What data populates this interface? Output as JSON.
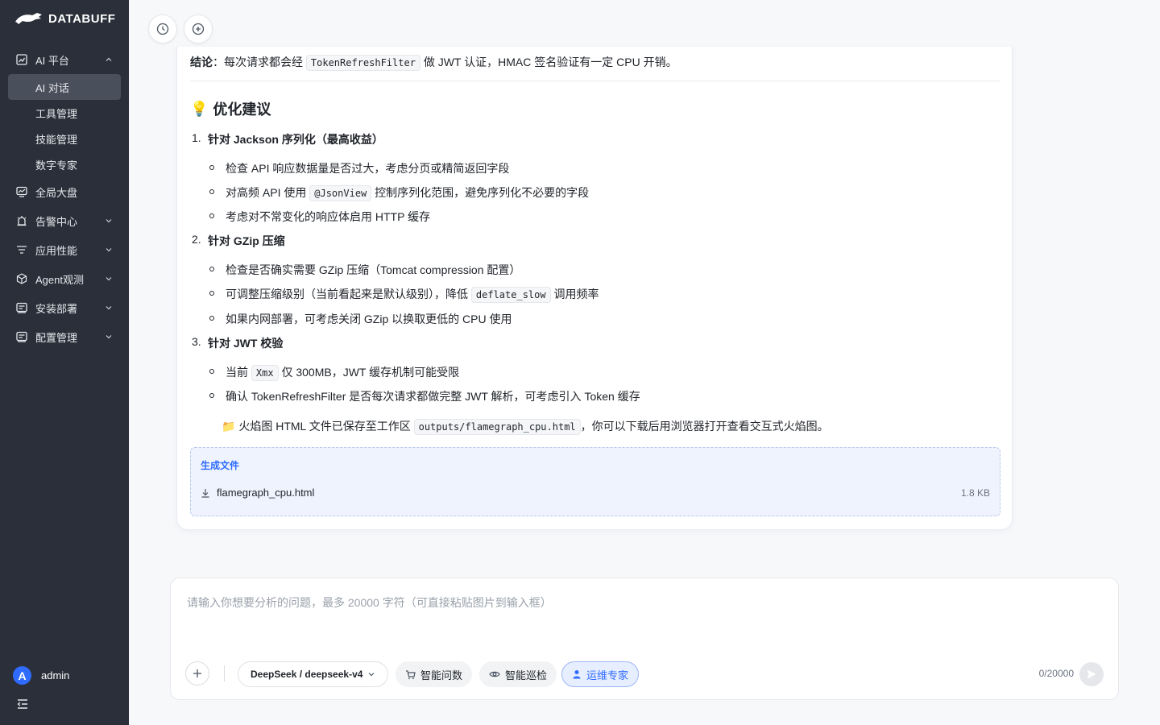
{
  "brand": {
    "name": "DATABUFF"
  },
  "sidebar": {
    "items": [
      {
        "label": "AI 平台",
        "expanded": true,
        "children": [
          {
            "label": "AI 对话",
            "active": true
          },
          {
            "label": "工具管理"
          },
          {
            "label": "技能管理"
          },
          {
            "label": "数字专家"
          }
        ]
      },
      {
        "label": "全局大盘"
      },
      {
        "label": "告警中心"
      },
      {
        "label": "应用性能"
      },
      {
        "label": "Agent观测"
      },
      {
        "label": "安装部署"
      },
      {
        "label": "配置管理"
      }
    ],
    "user": {
      "avatar_letter": "A",
      "name": "admin"
    }
  },
  "message": {
    "conclusion_label": "结论",
    "conclusion_pre": "：每次请求都会经",
    "conclusion_code": "TokenRefreshFilter",
    "conclusion_post": "做 JWT 认证，HMAC 签名验证有一定 CPU 开销。",
    "section_icon": "💡",
    "section_title": "优化建议",
    "items": [
      {
        "num": "1.",
        "title": "针对 Jackson 序列化（最高收益）",
        "bullets": [
          {
            "pre": "检查 API 响应数据量是否过大，考虑分页或精简返回字段"
          },
          {
            "pre": "对高频 API 使用",
            "code": "@JsonView",
            "post": "控制序列化范围，避免序列化不必要的字段"
          },
          {
            "pre": "考虑对不常变化的响应体启用 HTTP 缓存"
          }
        ]
      },
      {
        "num": "2.",
        "title": "针对 GZip 压缩",
        "bullets": [
          {
            "pre": "检查是否确实需要 GZip 压缩（Tomcat compression 配置）"
          },
          {
            "pre": "可调整压缩级别（当前看起来是默认级别），降低",
            "code": "deflate_slow",
            "post": "调用频率"
          },
          {
            "pre": "如果内网部署，可考虑关闭 GZip 以换取更低的 CPU 使用"
          }
        ]
      },
      {
        "num": "3.",
        "title": "针对 JWT 校验",
        "bullets": [
          {
            "pre": "当前",
            "code": "Xmx",
            "post": "仅 300MB，JWT 缓存机制可能受限"
          },
          {
            "pre": "确认 TokenRefreshFilter 是否每次请求都做完整 JWT 解析，可考虑引入 Token 缓存"
          }
        ]
      }
    ],
    "note_icon": "📁",
    "note_pre": "火焰图 HTML 文件已保存至工作区",
    "note_code": "outputs/flamegraph_cpu.html",
    "note_post": "，你可以下载后用浏览器打开查看交互式火焰图。",
    "files": {
      "title": "生成文件",
      "items": [
        {
          "name": "flamegraph_cpu.html",
          "size": "1.8 KB"
        }
      ]
    }
  },
  "composer": {
    "placeholder": "请输入你想要分析的问题，最多 20000 字符（可直接粘贴图片到输入框）",
    "model": "DeepSeek / deepseek-v4",
    "modes": [
      {
        "label": "智能问数",
        "icon": "cart-icon"
      },
      {
        "label": "智能巡检",
        "icon": "eye-icon"
      },
      {
        "label": "运维专家",
        "icon": "user-icon",
        "active": true
      }
    ],
    "counter": "0/20000"
  },
  "colors": {
    "accent": "#2f6bff",
    "sidebar_bg": "#2b2f3a"
  }
}
